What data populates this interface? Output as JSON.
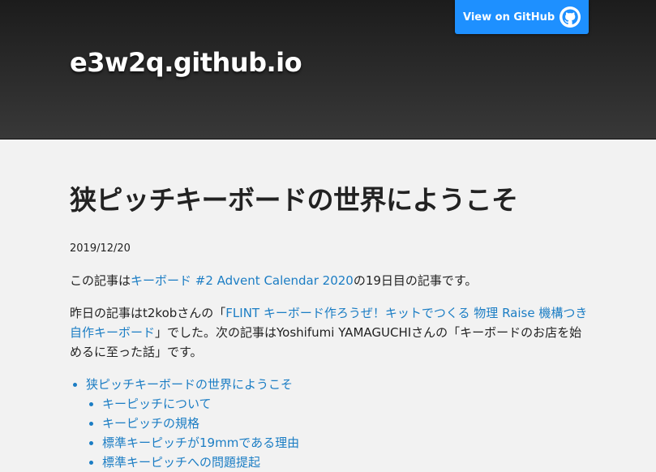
{
  "header": {
    "site_title": "e3w2q.github.io",
    "github_button": "View on GitHub",
    "github_icon": "github-octocat-icon"
  },
  "post": {
    "title": "狭ピッチキーボードの世界にようこそ",
    "date": "2019/12/20",
    "intro": {
      "prefix": "この記事は",
      "link": "キーボード #2 Advent Calendar 2020",
      "suffix": "の19日目の記事です。"
    },
    "prev_next": {
      "prefix": "昨日の記事はt2kobさんの「",
      "link": "FLINT キーボード作ろうぜ！キットでつくる 物理 Raise 機構つき自作キーボード",
      "suffix": "」でした。次の記事はYoshifumi YAMAGUCHIさんの「キーボードのお店を始めるに至った話」です。"
    },
    "toc": {
      "top": "狭ピッチキーボードの世界にようこそ",
      "children": [
        "キーピッチについて",
        "キーピッチの規格",
        "標準キーピッチが19mmである理由",
        "標準キーピッチへの問題提起"
      ]
    }
  },
  "colors": {
    "header_bg": "#2a2a2a",
    "page_bg": "#f2f2f2",
    "link": "#1b7dc4",
    "github_button_bg": "#1e90ff"
  }
}
